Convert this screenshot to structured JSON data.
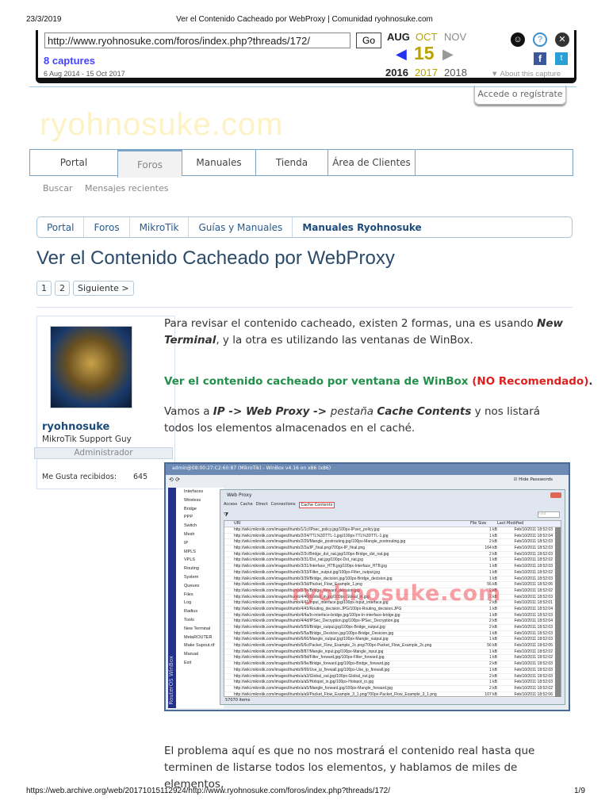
{
  "print_header": {
    "date": "23/3/2019",
    "title": "Ver el Contenido Cacheado por WebProxy | Comunidad ryohnosuke.com"
  },
  "wayback": {
    "url": "http://www.ryohnosuke.com/foros/index.php?threads/172/",
    "go": "Go",
    "captures": "8 captures",
    "range": "6 Aug 2014 - 15 Oct 2017",
    "months": [
      "AUG",
      "OCT",
      "NOV"
    ],
    "day": "15",
    "years": [
      "2016",
      "2017",
      "2018"
    ],
    "about": "About this capture"
  },
  "login": "Accede o regístrate",
  "logo": "ryohnosuke.com",
  "nav": {
    "tabs": [
      "Portal",
      "Foros",
      "Manuales",
      "Tienda",
      "Área de Clientes"
    ],
    "sub": [
      "Buscar",
      "Mensajes recientes"
    ]
  },
  "breadcrumb": [
    "Portal",
    "Foros",
    "MikroTik",
    "Guías y Manuales",
    "Manuales Ryohnosuke"
  ],
  "title": "Ver el Contenido Cacheado por WebProxy",
  "pagination": [
    "1",
    "2",
    "Siguiente >"
  ],
  "user": {
    "name": "ryohnosuke",
    "title": "MikroTik Support Guy",
    "role": "Administrador",
    "likes_label": "Me Gusta recibidos:",
    "likes": "645"
  },
  "post": {
    "p1a": "Para revisar el contenido cacheado, existen 2 formas, una es usando ",
    "p1b": "New Terminal",
    "p1c": ", y la otra es utilizando las ventanas de WinBox.",
    "h_green": "Ver el contenido cacheado por ventana de WinBox",
    "h_red": "(NO Recomendado)",
    "h_dot": ".",
    "p2a": "Vamos a ",
    "p2b": "IP -> Web Proxy -> ",
    "p2c": "pestaña ",
    "p2d": "Cache Contents",
    "p2e": " y nos listará todos los elementos almacenados en el caché.",
    "p3": "El problema aquí es que no nos mostrará el contenido real hasta que terminen de listarse todos los elementos, y hablamos de miles de elementos,"
  },
  "winbox": {
    "title": "admin@08:00:27:C2:60:87 (MikroTik) - WinBox v4.16 on x86 (x86)",
    "hide_pw": "Hide Passwords",
    "side_label": "RouterOS WinBox",
    "menu": [
      "Interfaces",
      "Wireless",
      "Bridge",
      "PPP",
      "Switch",
      "Mesh",
      "IP",
      "MPLS",
      "VPLS",
      "Routing",
      "System",
      "Queues",
      "Files",
      "Log",
      "Radius",
      "Tools",
      "New Terminal",
      "MetaROUTER",
      "Make Supout.rif",
      "Manual",
      "Exit"
    ],
    "dialog": "Web Proxy",
    "tabs": [
      "Access",
      "Cache",
      "Direct",
      "Connections",
      "Cache Contents"
    ],
    "find": "Find",
    "cols": [
      "URI",
      "File Size",
      "Last Modified"
    ],
    "watermark": "ryohnosuke.com",
    "items": "57070 items",
    "rows": [
      [
        "http://wiki.mikrotik.com/images/thumb/1/1c/IPsec_policy.jpg/100px-IPsec_policy.jpg",
        "1 kB",
        "Feb/10/2011 18:52:03"
      ],
      [
        "http://wiki.mikrotik.com/images/thumb/2/24/TTL%3DTTL-1.jpg/100px-TTL%3DTTL-1.jpg",
        "1 kB",
        "Feb/10/2011 18:52:04"
      ],
      [
        "http://wiki.mikrotik.com/images/thumb/2/29/Mangle_postrouting.jpg/100px-Mangle_postrouting.jpg",
        "2 kB",
        "Feb/10/2011 18:52:03"
      ],
      [
        "http://wiki.mikrotik.com/images/thumb/2/2a/IP_final.png/700px-IP_final.png",
        "164 kB",
        "Feb/10/2011 18:52:03"
      ],
      [
        "http://wiki.mikrotik.com/images/thumb/2/2c/Bridge_dst_nat.jpg/100px-Bridge_dst_nat.jpg",
        "2 kB",
        "Feb/10/2011 18:52:03"
      ],
      [
        "http://wiki.mikrotik.com/images/thumb/3/31/Dst_nat.jpg/100px-Dst_nat.jpg",
        "1 kB",
        "Feb/10/2011 18:52:02"
      ],
      [
        "http://wiki.mikrotik.com/images/thumb/3/31/Interface_HTB.jpg/100px-Interface_HTB.jpg",
        "1 kB",
        "Feb/10/2011 18:52:03"
      ],
      [
        "http://wiki.mikrotik.com/images/thumb/3/33/Filter_output.jpg/100px-Filter_output.jpg",
        "1 kB",
        "Feb/10/2011 18:52:02"
      ],
      [
        "http://wiki.mikrotik.com/images/thumb/3/39/Bridge_decision.jpg/100px-Bridge_decision.jpg",
        "1 kB",
        "Feb/10/2011 18:52:03"
      ],
      [
        "http://wiki.mikrotik.com/images/thumb/3/3d/Packet_Flow_Example_1.png",
        "56 kB",
        "Feb/10/2011 18:52:06"
      ],
      [
        "http://wiki.mikrotik.com/images/thumb/3/3e/Bridge_forward_decision.jpg",
        "2 kB",
        "Feb/10/2011 18:52:02"
      ],
      [
        "http://wiki.mikrotik.com/images/thumb/4/40/Global_in.jpg/100px-Global_in.jpg",
        "2 kB",
        "Feb/10/2011 18:52:03"
      ],
      [
        "http://wiki.mikrotik.com/images/thumb/4/41/Input_interface.jpg/100px-Input_interface.jpg",
        "2 kB",
        "Feb/10/2011 18:52:01"
      ],
      [
        "http://wiki.mikrotik.com/images/thumb/4/43/Routing_decision.JPG/100px-Routing_decision.JPG",
        "1 kB",
        "Feb/10/2011 18:52:04"
      ],
      [
        "http://wiki.mikrotik.com/images/thumb/4/4a/In-interface-bridge.jpg/100px-In-interface-bridge.jpg",
        "1 kB",
        "Feb/10/2011 18:52:03"
      ],
      [
        "http://wiki.mikrotik.com/images/thumb/4/4d/IPSec_Decryption.jpg/100px-IPSec_Decryption.jpg",
        "2 kB",
        "Feb/10/2011 18:52:04"
      ],
      [
        "http://wiki.mikrotik.com/images/thumb/5/59/Bridge_output.jpg/100px-Bridge_output.jpg",
        "2 kB",
        "Feb/10/2011 18:52:03"
      ],
      [
        "http://wiki.mikrotik.com/images/thumb/5/5a/Bridge_Desicion.jpg/100px-Bridge_Desicion.jpg",
        "1 kB",
        "Feb/10/2011 18:52:03"
      ],
      [
        "http://wiki.mikrotik.com/images/thumb/6/66/Mangle_output.jpg/100px-Mangle_output.jpg",
        "1 kB",
        "Feb/10/2011 18:52:03"
      ],
      [
        "http://wiki.mikrotik.com/images/thumb/6/6c/Packet_Flow_Example_2c.png/700px-Packet_Flow_Example_2c.png",
        "56 kB",
        "Feb/10/2011 18:52:05"
      ],
      [
        "http://wiki.mikrotik.com/images/thumb/8/87/Mangle_input.jpg/100px-Mangle_input.jpg",
        "1 kB",
        "Feb/10/2011 18:52:02"
      ],
      [
        "http://wiki.mikrotik.com/images/thumb/9/9d/Filter_forward.jpg/100px-Filter_forward.jpg",
        "1 kB",
        "Feb/10/2011 18:52:02"
      ],
      [
        "http://wiki.mikrotik.com/images/thumb/9/9e/Bridge_forward.jpg/100px-Bridge_forward.jpg",
        "2 kB",
        "Feb/10/2011 18:52:03"
      ],
      [
        "http://wiki.mikrotik.com/images/thumb/9/99/Use_ip_firewall.jpg/100px-Use_ip_firewall.jpg",
        "1 kB",
        "Feb/10/2011 18:52:03"
      ],
      [
        "http://wiki.mikrotik.com/images/thumb/a/a3/Global_out.jpg/100px-Global_out.jpg",
        "2 kB",
        "Feb/10/2011 18:52:03"
      ],
      [
        "http://wiki.mikrotik.com/images/thumb/a/a5/Hotspot_in.jpg/100px-Hotspot_in.jpg",
        "1 kB",
        "Feb/10/2011 18:52:03"
      ],
      [
        "http://wiki.mikrotik.com/images/thumb/a/a5/Mangle_forward.jpg/100px-Mangle_forward.jpg",
        "2 kB",
        "Feb/10/2011 18:52:02"
      ],
      [
        "http://wiki.mikrotik.com/images/thumb/a/a9/Packet_Flow_Example_3_1.png/700px-Packet_Flow_Example_3_1.png",
        "107 kB",
        "Feb/10/2011 18:52:06"
      ]
    ]
  },
  "print_footer": {
    "url": "https://web.archive.org/web/20171015112924/http://www.ryohnosuke.com/foros/index.php?threads/172/",
    "page": "1/9"
  }
}
